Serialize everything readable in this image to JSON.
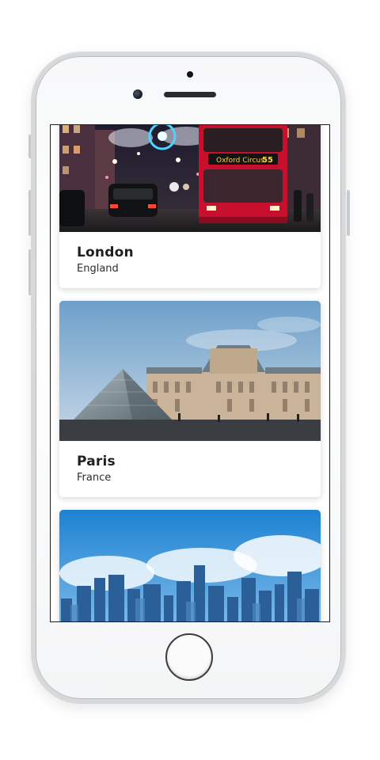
{
  "destinations": [
    {
      "city": "London",
      "country": "England",
      "photo": "london-street-photo"
    },
    {
      "city": "Paris",
      "country": "France",
      "photo": "paris-louvre-photo"
    },
    {
      "city": "",
      "country": "",
      "photo": "city-skyline-photo"
    }
  ],
  "london_photo_text": {
    "bus_destination": "Oxford Circus",
    "bus_route": "55"
  },
  "colors": {
    "card_bg": "#ffffff",
    "text_primary": "#1f1f21",
    "phone_frame": "#d6d8da"
  }
}
